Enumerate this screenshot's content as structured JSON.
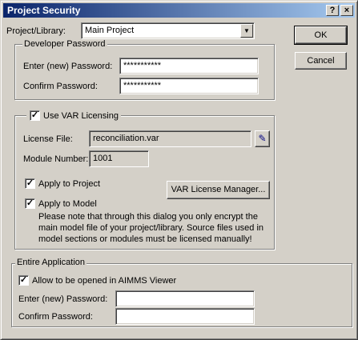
{
  "window": {
    "title": "Project Security",
    "help_label": "?",
    "close_label": "×"
  },
  "project": {
    "label": "Project/Library:",
    "selected": "Main Project"
  },
  "buttons": {
    "ok": "OK",
    "cancel": "Cancel",
    "browse": "...",
    "var_manager": "VAR License Manager..."
  },
  "developer": {
    "legend": "Developer Password",
    "enter_label": "Enter (new) Password:",
    "enter_value": "***********",
    "confirm_label": "Confirm Password:",
    "confirm_value": "***********"
  },
  "var": {
    "use_label": "Use VAR Licensing",
    "use_checked": true,
    "license_file_label": "License File:",
    "license_file_value": "reconciliation.var",
    "module_label": "Module Number:",
    "module_value": "1001",
    "apply_project_label": "Apply to Project",
    "apply_project_checked": true,
    "apply_model_label": "Apply to Model",
    "apply_model_checked": true,
    "note_line1": "Please note that through this dialog you only encrypt the",
    "note_line2": "main model file of your project/library.  Source files used in",
    "note_line3": "model sections or modules must be licensed manually!"
  },
  "entire": {
    "legend": "Entire Application",
    "allow_label": "Allow to be opened in AIMMS Viewer",
    "allow_checked": true,
    "enter_label": "Enter (new) Password:",
    "enter_value": "",
    "confirm_label": "Confirm Password:",
    "confirm_value": ""
  },
  "glyphs": {
    "check": "✓",
    "dropdown_arrow": "▼",
    "edit": "✎"
  }
}
